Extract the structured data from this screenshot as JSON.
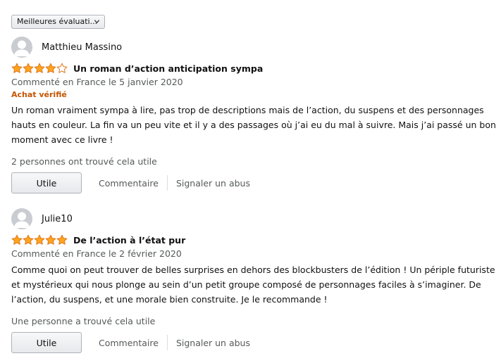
{
  "sort": {
    "label": "Meilleures évaluati..."
  },
  "reviews": [
    {
      "author": "Matthieu Massino",
      "rating": 4,
      "title": "Un roman d’action anticipation sympa",
      "meta": "Commenté en France le 5 janvier 2020",
      "verified": "Achat vérifié",
      "body": "Un roman vraiment sympa à lire, pas trop de descriptions mais de l’action, du suspens et des personnages hauts en couleur. La fin va un peu vite et il y a des passages où j’ai eu du mal à suivre. Mais j’ai passé un bon moment avec ce livre !",
      "helpful": "2 personnes ont trouvé cela utile",
      "useful_label": "Utile",
      "comment_label": "Commentaire",
      "report_label": "Signaler un abus"
    },
    {
      "author": "Julie10",
      "rating": 5,
      "title": "De l’action à l’état pur",
      "meta": "Commenté en France le 2 février 2020",
      "body": "Comme quoi on peut trouver de belles surprises en dehors des blockbusters de l’édition ! Un périple futuriste et mystérieux qui nous plonge au sein d’un petit groupe composé de personnages faciles à s’imaginer. De l’action, du suspens, et une morale bien construite. Je le recommande !",
      "helpful": "Une personne a trouvé cela utile",
      "useful_label": "Utile",
      "comment_label": "Commentaire",
      "report_label": "Signaler un abus"
    }
  ],
  "colors": {
    "star": "#ffa41c",
    "star_outline": "#de7921",
    "verified": "#c45500",
    "muted": "#565959"
  }
}
